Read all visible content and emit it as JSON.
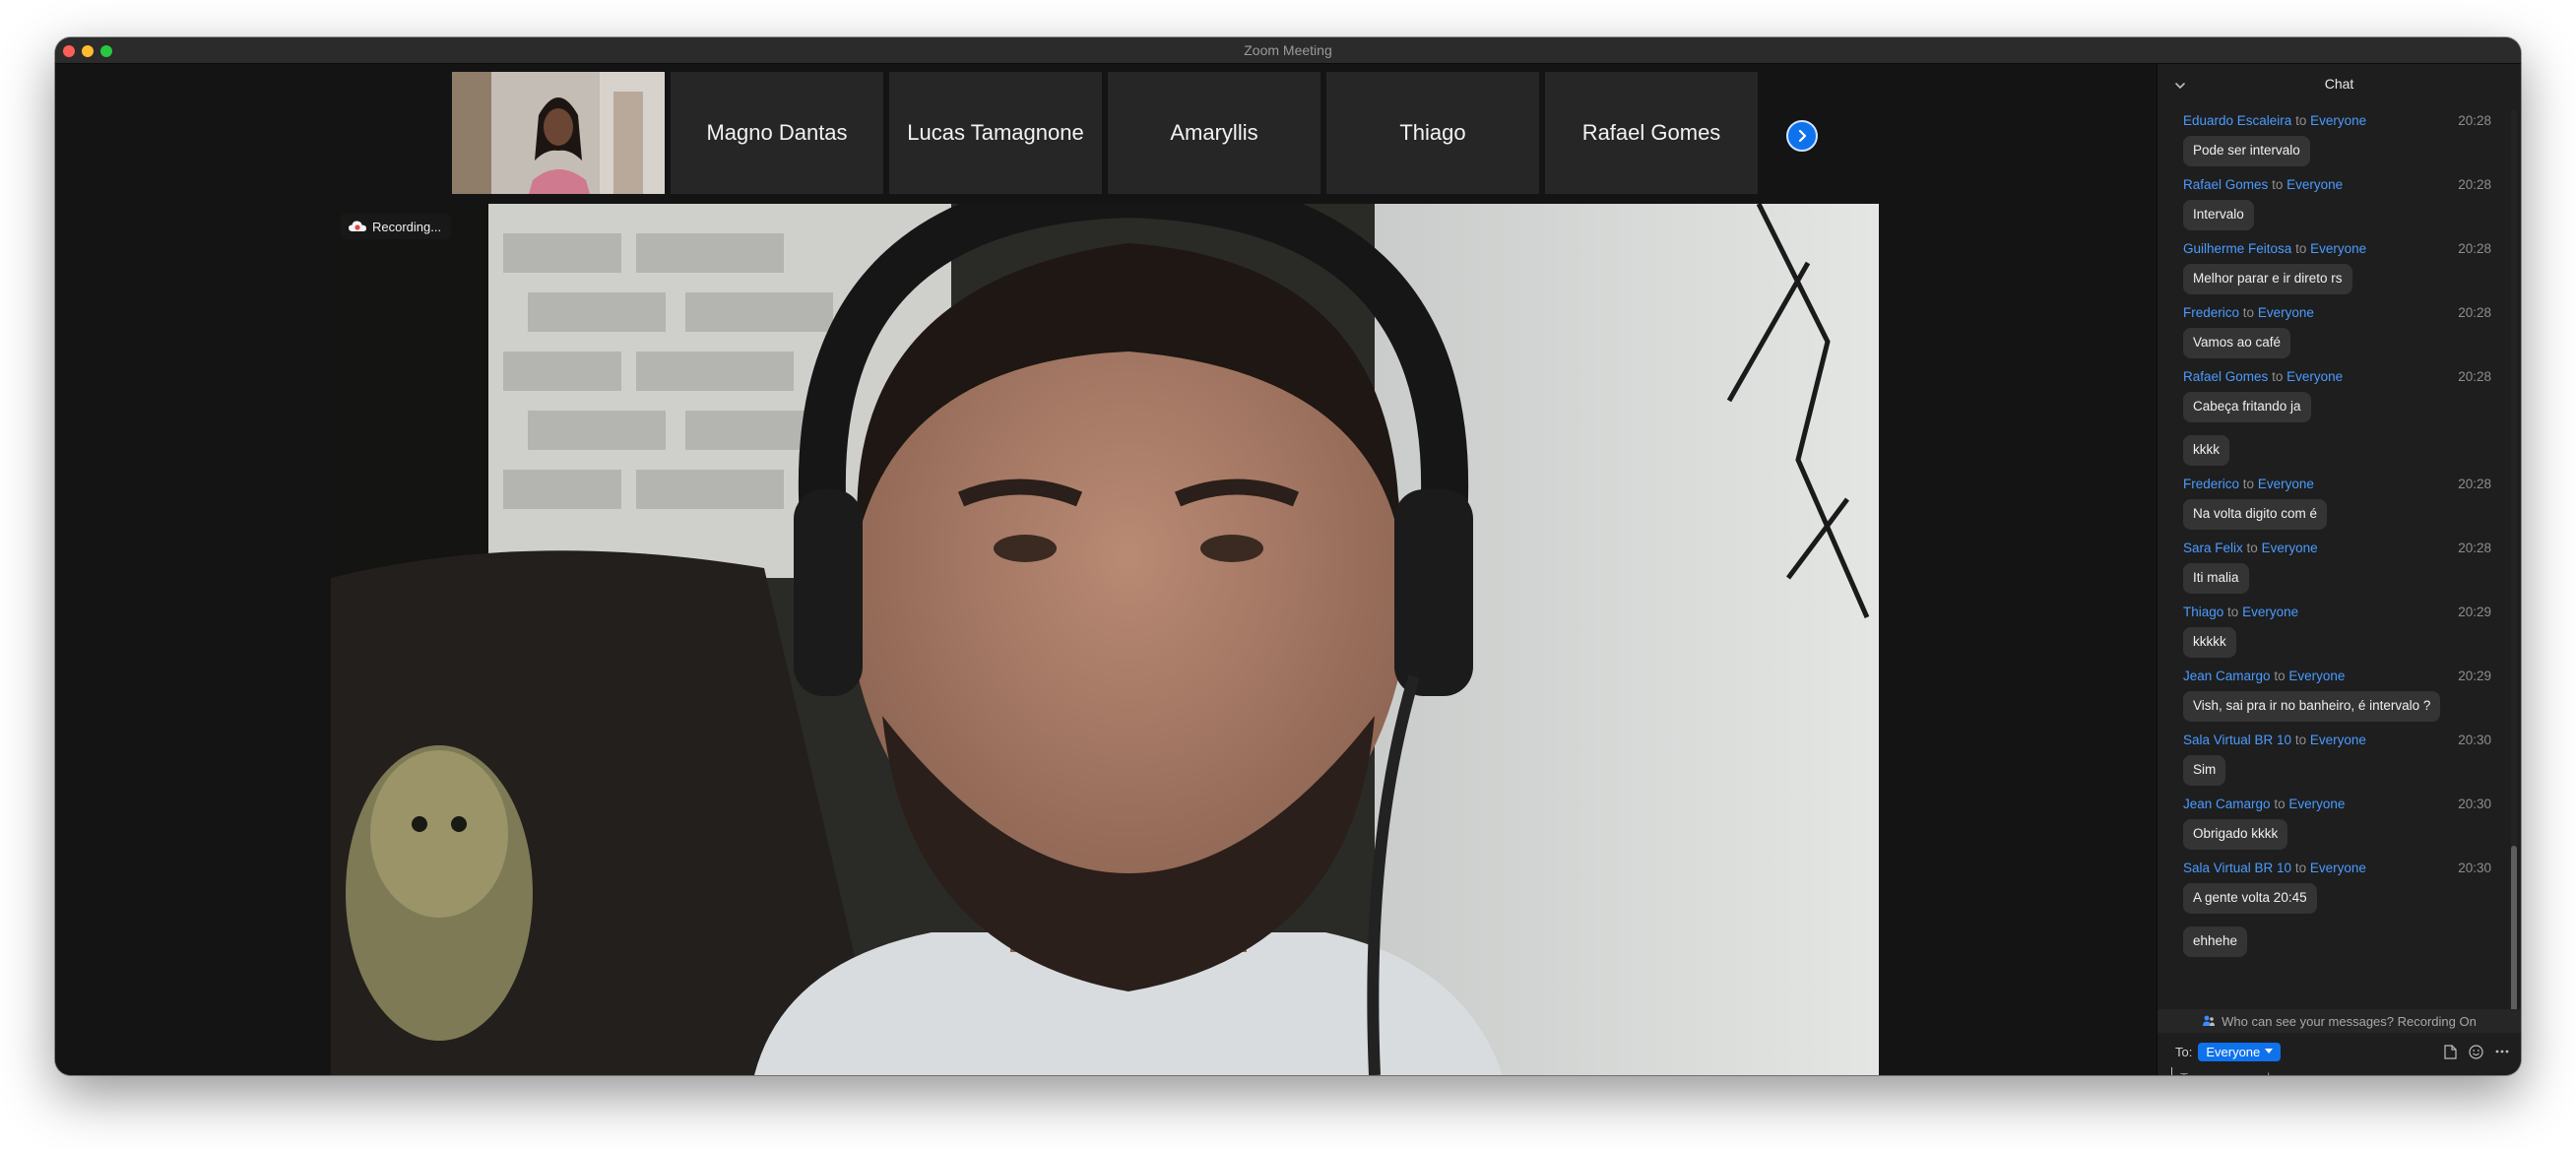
{
  "window": {
    "title": "Zoom Meeting"
  },
  "participants": [
    {
      "name": "Magno Dantas"
    },
    {
      "name": "Lucas Tamagnone"
    },
    {
      "name": "Amaryllis"
    },
    {
      "name": "Thiago"
    },
    {
      "name": "Rafael Gomes"
    }
  ],
  "main_video": {
    "recording_label": "Recording..."
  },
  "chat": {
    "title": "Chat",
    "messages": [
      {
        "sender": "Eduardo Escaleira",
        "to_word": "to",
        "recipient": "Everyone",
        "time": "20:28",
        "text": "Pode ser intervalo"
      },
      {
        "sender": "Rafael Gomes",
        "to_word": "to",
        "recipient": "Everyone",
        "time": "20:28",
        "text": "Intervalo"
      },
      {
        "sender": "Guilherme Feitosa",
        "to_word": "to",
        "recipient": "Everyone",
        "time": "20:28",
        "text": "Melhor parar e ir direto rs"
      },
      {
        "sender": "Frederico",
        "to_word": "to",
        "recipient": "Everyone",
        "time": "20:28",
        "text": "Vamos ao café"
      },
      {
        "sender": "Rafael Gomes",
        "to_word": "to",
        "recipient": "Everyone",
        "time": "20:28",
        "text": "Cabeça fritando ja"
      },
      {
        "text": "kkkk"
      },
      {
        "sender": "Frederico",
        "to_word": "to",
        "recipient": "Everyone",
        "time": "20:28",
        "text": "Na volta digito com é"
      },
      {
        "sender": "Sara Felix",
        "to_word": "to",
        "recipient": "Everyone",
        "time": "20:28",
        "text": "Iti malia"
      },
      {
        "sender": "Thiago",
        "to_word": "to",
        "recipient": "Everyone",
        "time": "20:29",
        "text": "kkkkk"
      },
      {
        "sender": "Jean Camargo",
        "to_word": "to",
        "recipient": "Everyone",
        "time": "20:29",
        "text": "Vish, sai pra ir no banheiro, é intervalo ?"
      },
      {
        "sender": "Sala Virtual BR 10",
        "to_word": "to",
        "recipient": "Everyone",
        "time": "20:30",
        "text": "Sim"
      },
      {
        "sender": "Jean Camargo",
        "to_word": "to",
        "recipient": "Everyone",
        "time": "20:30",
        "text": "Obrigado kkkk"
      },
      {
        "sender": "Sala Virtual BR 10",
        "to_word": "to",
        "recipient": "Everyone",
        "time": "20:30",
        "text": "A gente volta 20:45"
      },
      {
        "text": "ehhehe"
      }
    ],
    "privacy_notice": "Who can see your messages? Recording On",
    "to_label": "To:",
    "to_value": "Everyone",
    "input_placeholder": "Type message here..."
  },
  "colors": {
    "accent": "#0e72ed",
    "chat_link": "#4a9bff",
    "traffic_close": "#ff5f57",
    "traffic_min": "#febc2e",
    "traffic_max": "#28c840"
  },
  "icons": {
    "collapse": "chevron-down-icon",
    "next": "chevron-right-icon",
    "recording": "cloud-recording-icon",
    "privacy": "people-icon",
    "file": "file-icon",
    "emoji": "emoji-icon",
    "more": "more-icon"
  }
}
